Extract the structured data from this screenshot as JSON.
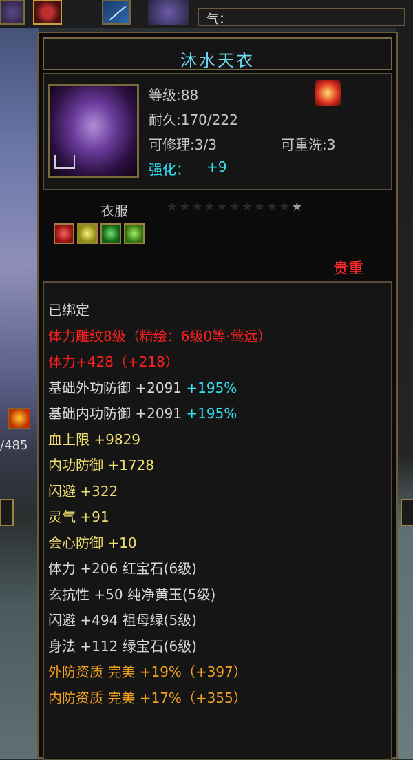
{
  "top": {
    "qi_label": "气："
  },
  "left": {
    "hp_fragment": "/485"
  },
  "item": {
    "name": "沐水天衣",
    "level": "等级:88",
    "durability": "耐久:170/222",
    "repair": "可修理:3/3",
    "rewash": "可重洗:3",
    "enhance_label": "强化：",
    "enhance_value": "+9",
    "category": "衣服",
    "stars": "★★★★★★★★★★",
    "star_lit": "★",
    "rarity": "贵重"
  },
  "colors": {
    "title": "#6fd8f0",
    "red": "#ff2020",
    "yellow": "#f0e070",
    "orange": "#f0a020",
    "cyan": "#32e0f0"
  },
  "stats": [
    {
      "a": "已绑定",
      "b": "",
      "c": "",
      "color": "white"
    },
    {
      "a": "体力雕纹8级（精绘：6级0等·莺远）",
      "b": "",
      "c": "",
      "color": "red"
    },
    {
      "a": "体力+428（+218）",
      "b": "",
      "c": "",
      "color": "red"
    },
    {
      "a": "基础外功防御 ",
      "b": "+2091 ",
      "c": "+195%",
      "color": "white"
    },
    {
      "a": "基础内功防御 ",
      "b": "+2091 ",
      "c": "+195%",
      "color": "white"
    },
    {
      "a": "血上限 ",
      "b": "+9829",
      "c": "",
      "color": "yellow"
    },
    {
      "a": "内功防御 ",
      "b": "+1728",
      "c": "",
      "color": "yellow"
    },
    {
      "a": "闪避 ",
      "b": "+322",
      "c": "",
      "color": "yellow"
    },
    {
      "a": "灵气 ",
      "b": "+91",
      "c": "",
      "color": "yellow"
    },
    {
      "a": "会心防御 ",
      "b": "+10",
      "c": "",
      "color": "yellow"
    },
    {
      "a": "体力 ",
      "b": "+206 红宝石(6级)",
      "c": "",
      "color": "white"
    },
    {
      "a": "玄抗性 ",
      "b": "+50 纯净黄玉(5级)",
      "c": "",
      "color": "white"
    },
    {
      "a": "闪避 ",
      "b": "+494 祖母绿(5级)",
      "c": "",
      "color": "white"
    },
    {
      "a": "身法 ",
      "b": "+112 绿宝石(6级)",
      "c": "",
      "color": "white"
    },
    {
      "a": "外防资质  ",
      "b": "完美 +19%（+397）",
      "c": "",
      "color": "orange"
    },
    {
      "a": "内防资质  ",
      "b": "完美 +17%（+355）",
      "c": "",
      "color": "orange"
    }
  ]
}
